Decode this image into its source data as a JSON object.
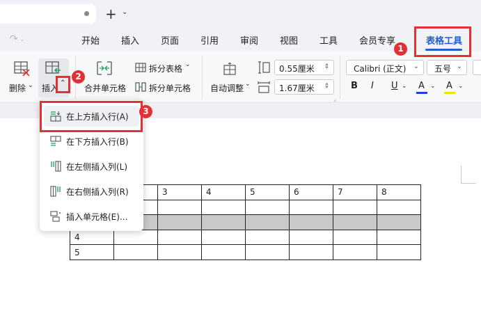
{
  "titlebar": {
    "new_tab_symbol": "+",
    "new_tab_menu_symbol": "⌄"
  },
  "menubar": {
    "tabs": [
      "开始",
      "插入",
      "页面",
      "引用",
      "审阅",
      "视图",
      "工具",
      "会员专享"
    ],
    "active_tab": "表格工具",
    "accent_color": "#1f5fd1"
  },
  "ribbon": {
    "delete_label": "删除",
    "insert_label": "插入",
    "merge_label": "合并单元格",
    "split_table_label": "拆分表格",
    "split_cell_label": "拆分单元格",
    "autofit_label": "自动调整",
    "row_height": "0.55厘米",
    "col_width": "1.67厘米",
    "font_name": "Calibri (正文)",
    "font_size": "五号",
    "bold": "B",
    "italic": "I",
    "underline": "U",
    "font_color_letter": "A",
    "highlight_letter": "A"
  },
  "dropdown": {
    "items": [
      {
        "label": "在上方插入行(A)",
        "icon": "insert-row-above-icon"
      },
      {
        "label": "在下方插入行(B)",
        "icon": "insert-row-below-icon"
      },
      {
        "label": "在左侧插入列(L)",
        "icon": "insert-col-left-icon"
      },
      {
        "label": "在右侧插入列(R)",
        "icon": "insert-col-right-icon"
      },
      {
        "label": "插入单元格(E)...",
        "icon": "insert-cell-icon"
      }
    ]
  },
  "table": {
    "rows": [
      [
        "",
        "",
        "3",
        "4",
        "5",
        "6",
        "7",
        "8"
      ],
      [
        "",
        "",
        "",
        "",
        "",
        "",
        "",
        ""
      ],
      [
        "",
        "",
        "",
        "",
        "",
        "",
        "",
        ""
      ],
      [
        "4",
        "",
        "",
        "",
        "",
        "",
        "",
        ""
      ],
      [
        "5",
        "",
        "",
        "",
        "",
        "",
        "",
        ""
      ]
    ],
    "selected_row_index": 2
  },
  "annotations": {
    "badges": [
      "1",
      "2",
      "3"
    ],
    "color": "#e33033"
  }
}
